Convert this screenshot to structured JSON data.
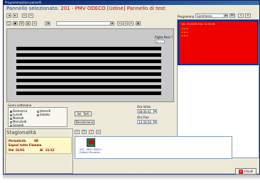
{
  "window": {
    "title": "Programmazione pannelli"
  },
  "header": {
    "label": "Pannello selezionato:",
    "value": "201 - PMV ODECO [Udine] Pannello di test"
  },
  "program": {
    "label": "Programma",
    "value": "Commerce",
    "ninety_label": "90",
    "preview_code": "Cal: 05/10/05  Ora: 11:39:58"
  },
  "editor": {
    "blocked_label": "Righe fisse ?",
    "blocked_value": "0",
    "line_count": 8
  },
  "days": {
    "label": "Giorni settimana",
    "items": [
      {
        "label": "Domenica",
        "checked": true
      },
      {
        "label": "Lunedì",
        "checked": false
      },
      {
        "label": "Martedì",
        "checked": false
      },
      {
        "label": "Mercoledì",
        "checked": false
      },
      {
        "label": "Giovedì",
        "checked": false
      },
      {
        "label": "Venerdì",
        "checked": false
      },
      {
        "label": "Sabato",
        "checked": false
      }
    ],
    "select_all": "Sel. Tutti",
    "deselect": "Deseleziona"
  },
  "time": {
    "start_label": "Ora Inizio",
    "start_value": "08:00:01",
    "end_label": "Ora Fine",
    "end_value": "23:59:59"
  },
  "season": {
    "title": "Stagionalità",
    "period_label": "Periodicità",
    "period_value": "SR",
    "text_label": "Esposi tutto Fiamma",
    "from_label": "Dal",
    "from_value": "01/01",
    "to_label": "Al",
    "to_value": "31/12"
  },
  "thumb": {
    "caption_line1": "201 - PMV ODECO",
    "caption_line2": "[Udine] Pannello..."
  },
  "footer": {
    "close_label": "Chiudi"
  },
  "colors": {
    "titlebar": "#0a246a",
    "preview_bg": "#ec0000",
    "preview_frame": "#0a2f8a",
    "led": "#000000",
    "editor_bg": "#c9c9c9"
  }
}
